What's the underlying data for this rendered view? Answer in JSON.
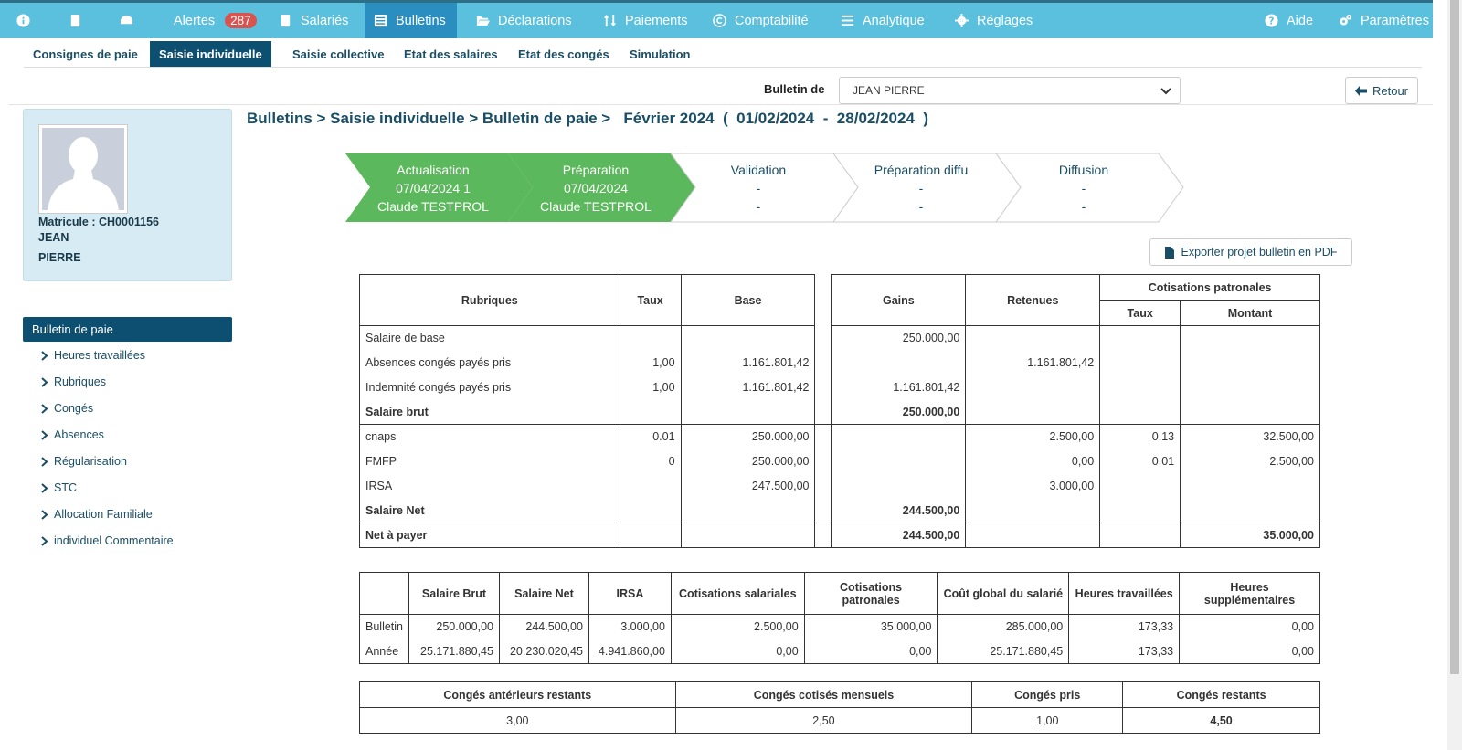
{
  "nav": {
    "alertes_label": "Alertes",
    "alertes_count": "287",
    "salaries": "Salariés",
    "bulletins": "Bulletins",
    "declarations": "Déclarations",
    "paiements": "Paiements",
    "comptabilite": "Comptabilité",
    "analytique": "Analytique",
    "reglages": "Réglages",
    "aide": "Aide",
    "parametres": "Paramètres"
  },
  "subnav": {
    "consignes": "Consignes de paie",
    "saisie_individuelle": "Saisie individuelle",
    "saisie_collective": "Saisie collective",
    "etat_salaires": "Etat des salaires",
    "etat_conges": "Etat des congés",
    "simulation": "Simulation"
  },
  "bulletin_selector": {
    "label": "Bulletin de",
    "value": "JEAN PIERRE"
  },
  "retour": "Retour",
  "employee": {
    "matricule": "Matricule : CH0001156",
    "nom": "JEAN",
    "prenom": "PIERRE"
  },
  "sidemenu": {
    "head": "Bulletin de paie",
    "items": [
      "Heures travaillées",
      "Rubriques",
      "Congés",
      "Absences",
      "Régularisation",
      "STC",
      "Allocation Familiale",
      "individuel Commentaire"
    ]
  },
  "breadcrumb": "Bulletins > Saisie individuelle > Bulletin de paie >   Février 2024  (  01/02/2024  -  28/02/2024  )",
  "steps": [
    {
      "title": "Actualisation",
      "line2": "07/04/2024 1",
      "line3": "Claude TESTPROL"
    },
    {
      "title": "Préparation",
      "line2": "07/04/2024",
      "line3": "Claude TESTPROL"
    },
    {
      "title": "Validation",
      "line2": "-",
      "line3": "-"
    },
    {
      "title": "Préparation diffu",
      "line2": "-",
      "line3": "-"
    },
    {
      "title": "Diffusion",
      "line2": "-",
      "line3": "-"
    }
  ],
  "export_label": "Exporter projet bulletin en PDF",
  "main_table": {
    "headers": {
      "rubriques": "Rubriques",
      "taux": "Taux",
      "base": "Base",
      "gains": "Gains",
      "retenues": "Retenues",
      "cotisations": "Cotisations patronales",
      "cot_taux": "Taux",
      "cot_montant": "Montant"
    },
    "group1": [
      {
        "rubrique": "Salaire de base",
        "taux": "",
        "base": "",
        "gains": "250.000,00",
        "retenues": "",
        "ctaux": "",
        "cmontant": "",
        "bold": false
      },
      {
        "rubrique": "Absences congés payés pris",
        "taux": "1,00",
        "base": "1.161.801,42",
        "gains": "",
        "retenues": "1.161.801,42",
        "ctaux": "",
        "cmontant": "",
        "bold": false
      },
      {
        "rubrique": "Indemnité congés payés pris",
        "taux": "1,00",
        "base": "1.161.801,42",
        "gains": "1.161.801,42",
        "retenues": "",
        "ctaux": "",
        "cmontant": "",
        "bold": false
      },
      {
        "rubrique": "Salaire brut",
        "taux": "",
        "base": "",
        "gains": "250.000,00",
        "retenues": "",
        "ctaux": "",
        "cmontant": "",
        "bold": true
      }
    ],
    "group2": [
      {
        "rubrique": "cnaps",
        "taux": "0.01",
        "base": "250.000,00",
        "gains": "",
        "retenues": "2.500,00",
        "ctaux": "0.13",
        "cmontant": "32.500,00",
        "bold": false
      },
      {
        "rubrique": "FMFP",
        "taux": "0",
        "base": "250.000,00",
        "gains": "",
        "retenues": "0,00",
        "ctaux": "0.01",
        "cmontant": "2.500,00",
        "bold": false
      },
      {
        "rubrique": "IRSA",
        "taux": "",
        "base": "247.500,00",
        "gains": "",
        "retenues": "3.000,00",
        "ctaux": "",
        "cmontant": "",
        "bold": false
      },
      {
        "rubrique": "Salaire Net",
        "taux": "",
        "base": "",
        "gains": "244.500,00",
        "retenues": "",
        "ctaux": "",
        "cmontant": "",
        "bold": true
      }
    ],
    "total": {
      "rubrique": "Net à payer",
      "gains": "244.500,00",
      "cmontant": "35.000,00"
    }
  },
  "summary_table": {
    "headers": [
      "",
      "Salaire Brut",
      "Salaire Net",
      "IRSA",
      "Cotisations salariales",
      "Cotisations patronales",
      "Coût global du salarié",
      "Heures travaillées",
      "Heures supplémentaires"
    ],
    "rows": [
      [
        "Bulletin",
        "250.000,00",
        "244.500,00",
        "3.000,00",
        "2.500,00",
        "35.000,00",
        "285.000,00",
        "173,33",
        "0,00"
      ],
      [
        "Année",
        "25.171.880,45",
        "20.230.020,45",
        "4.941.860,00",
        "0,00",
        "0,00",
        "25.171.880,45",
        "173,33",
        "0,00"
      ]
    ]
  },
  "conges_table": {
    "headers": [
      "Congés antérieurs restants",
      "Congés cotisés mensuels",
      "Congés pris",
      "Congés restants"
    ],
    "values": [
      "3,00",
      "2,50",
      "1,00",
      "4,50"
    ]
  },
  "colors": {
    "nav_bg": "#5bc0de",
    "nav_active": "#2a8fc0",
    "dark_blue": "#0d4f70",
    "step_done": "#5cb85c",
    "badge": "#d9534f"
  }
}
